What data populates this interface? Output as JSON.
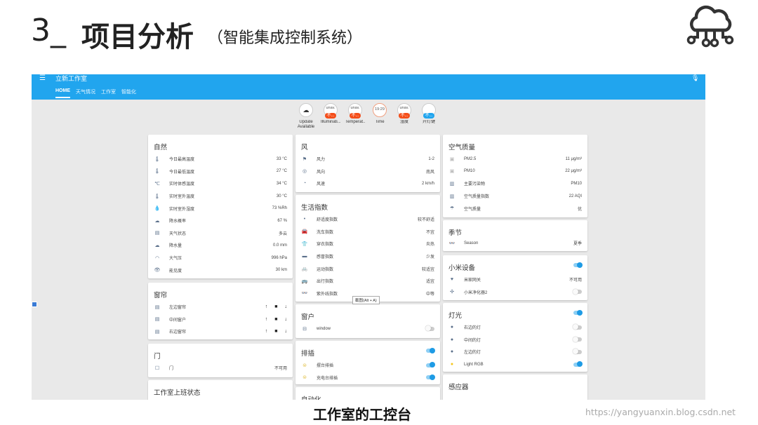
{
  "slide": {
    "number": "3_",
    "title": "项目分析",
    "subtitle": "（智能集成控制系统）",
    "caption": "工作室的工控台",
    "watermark": "https://yangyuanxin.blog.csdn.net"
  },
  "app": {
    "title": "立新工作室",
    "menu_icon": "menu-icon",
    "mic_icon": "mic-icon",
    "tabs": [
      {
        "label": "HOME"
      },
      {
        "label": "天气情况"
      },
      {
        "label": "工作室"
      },
      {
        "label": "智能化"
      }
    ]
  },
  "badges": [
    {
      "top": "",
      "pill": "",
      "label": "Update Available",
      "icon": "cloud-upload-icon"
    },
    {
      "top": "unav.",
      "pill": "不...",
      "label": "Illuminati..."
    },
    {
      "top": "unav.",
      "pill": "不...",
      "label": "Temperat..."
    },
    {
      "top": "19:29",
      "pill": "",
      "label": "Time"
    },
    {
      "top": "unav.",
      "pill": "不...",
      "label": "湿度"
    },
    {
      "top": "",
      "pill": "不...",
      "label": "开灯键"
    }
  ],
  "nature": {
    "title": "自然",
    "rows": [
      {
        "icon": "thermometer-icon",
        "label": "今日最高温度",
        "value": "33 °C"
      },
      {
        "icon": "thermometer-icon",
        "label": "今日最低温度",
        "value": "27 °C"
      },
      {
        "icon": "celsius-icon",
        "label": "实时体感温度",
        "value": "34 °C"
      },
      {
        "icon": "thermometer-icon",
        "label": "实时室外温度",
        "value": "30 °C"
      },
      {
        "icon": "water-drop-icon",
        "label": "实时室外湿度",
        "value": "73 %Rh"
      },
      {
        "icon": "rain-cloud-icon",
        "label": "降水概率",
        "value": "67 %"
      },
      {
        "icon": "weather-state-icon",
        "label": "天气状态",
        "value": "多云"
      },
      {
        "icon": "rain-cloud-icon",
        "label": "降水量",
        "value": "0.0 mm"
      },
      {
        "icon": "gauge-icon",
        "label": "大气压",
        "value": "996 hPa"
      },
      {
        "icon": "eye-icon",
        "label": "能见度",
        "value": "30 km"
      }
    ]
  },
  "curtain": {
    "title": "窗帘",
    "rows": [
      {
        "label": "左边窗帘"
      },
      {
        "label": "中间窗户"
      },
      {
        "label": "右边窗帘"
      }
    ],
    "up": "↑",
    "stop": "■",
    "down": "↓"
  },
  "door": {
    "title": "门",
    "rows": [
      {
        "label": "门",
        "value": "不可用"
      }
    ]
  },
  "office": {
    "title": "工作室上班状态"
  },
  "wind": {
    "title": "风",
    "rows": [
      {
        "icon": "flag-icon",
        "label": "风力",
        "value": "1-2"
      },
      {
        "icon": "compass-icon",
        "label": "风向",
        "value": "南风"
      },
      {
        "icon": "gauge-icon",
        "label": "风速",
        "value": "2 km/h"
      }
    ]
  },
  "life": {
    "title": "生活指数",
    "rows": [
      {
        "icon": "comfort-icon",
        "label": "舒适度指数",
        "value": "较不舒适"
      },
      {
        "icon": "car-icon",
        "label": "洗车指数",
        "value": "不宜"
      },
      {
        "icon": "clothes-icon",
        "label": "穿衣指数",
        "value": "炎热"
      },
      {
        "icon": "flu-icon",
        "label": "感冒指数",
        "value": "少发"
      },
      {
        "icon": "bike-icon",
        "label": "运动指数",
        "value": "较适宜"
      },
      {
        "icon": "bus-icon",
        "label": "出行指数",
        "value": "适宜"
      },
      {
        "icon": "sunglasses-icon",
        "label": "紫外线指数",
        "value": "中等"
      }
    ],
    "tooltip": "截图(Alt + A)"
  },
  "window": {
    "title": "窗户",
    "rows": [
      {
        "icon": "window-icon",
        "label": "window"
      }
    ]
  },
  "socket": {
    "title": "排插",
    "rows": [
      {
        "icon": "socket-icon",
        "label": "摆台排插"
      },
      {
        "icon": "socket-icon",
        "label": "充电台排插"
      }
    ]
  },
  "auto": {
    "title": "自动化"
  },
  "air": {
    "title": "空气质量",
    "rows": [
      {
        "icon": "pm-icon",
        "label": "PM2.5",
        "value": "11 μg/m³"
      },
      {
        "icon": "pm-icon",
        "label": "PM10",
        "value": "22 μg/m³"
      },
      {
        "icon": "bar-chart-icon",
        "label": "主要污染物",
        "value": "PM10"
      },
      {
        "icon": "bar-chart-icon",
        "label": "空气质量指数",
        "value": "22 AQI"
      },
      {
        "icon": "air-quality-icon",
        "label": "空气质量",
        "value": "优"
      }
    ]
  },
  "season": {
    "title": "季节",
    "rows": [
      {
        "icon": "sunglasses-icon",
        "label": "Season",
        "value": "夏季"
      }
    ]
  },
  "xiaomi": {
    "title": "小米设备",
    "rows": [
      {
        "icon": "gateway-icon",
        "label": "米家网关",
        "value": "不可用"
      },
      {
        "icon": "purifier-icon",
        "label": "小米净化器2"
      }
    ]
  },
  "light": {
    "title": "灯光",
    "rows": [
      {
        "icon": "bulb-icon",
        "label": "右边的灯"
      },
      {
        "icon": "bulb-icon",
        "label": "中间的灯"
      },
      {
        "icon": "bulb-icon",
        "label": "左边的灯"
      },
      {
        "icon": "bulb-icon",
        "label": "Light RGB"
      }
    ]
  },
  "sensor": {
    "title": "感应器"
  }
}
